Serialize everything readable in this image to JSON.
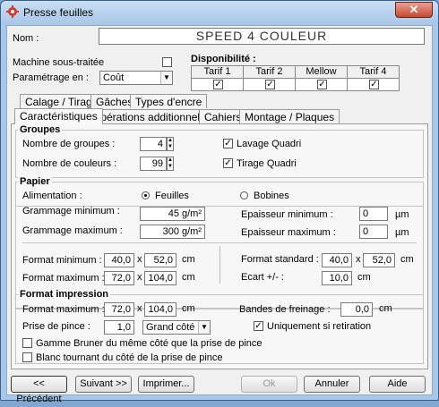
{
  "window": {
    "title": "Presse feuilles",
    "close_glyph": "✕"
  },
  "header": {
    "name_label": "Nom :",
    "name_value": "SPEED 4 COULEUR",
    "sous_traitee_label": "Machine sous-traitée",
    "parametrage_label": "Paramétrage en :",
    "parametrage_value": "Coût",
    "disponibilite_label": "Disponibilité :",
    "tarifs": [
      "Tarif 1",
      "Tarif 2",
      "Mellow",
      "Tarif 4"
    ],
    "tarifs_checked": [
      true,
      true,
      true,
      true
    ]
  },
  "tabs_row1": [
    "Calage / Tirage",
    "Gâches",
    "Types d'encre"
  ],
  "tabs_row2": [
    "Caractéristiques",
    "Opérations additionnelles",
    "Cahiers",
    "Montage / Plaques"
  ],
  "active_tab": "Caractéristiques",
  "groupes": {
    "title": "Groupes",
    "nb_groupes_label": "Nombre de groupes :",
    "nb_groupes_value": "4",
    "nb_couleurs_label": "Nombre de couleurs :",
    "nb_couleurs_value": "99",
    "lavage_label": "Lavage Quadri",
    "lavage_checked": true,
    "tirage_label": "Tirage Quadri",
    "tirage_checked": true
  },
  "papier": {
    "title": "Papier",
    "alimentation_label": "Alimentation :",
    "feuilles_label": "Feuilles",
    "bobines_label": "Bobines",
    "grammage_min_label": "Grammage minimum :",
    "grammage_min_value": "45 g/m²",
    "grammage_max_label": "Grammage maximum :",
    "grammage_max_value": "300 g/m²",
    "epaisseur_min_label": "Epaisseur minimum :",
    "epaisseur_min_value": "0",
    "epaisseur_max_label": "Epaisseur maximum :",
    "epaisseur_max_value": "0",
    "um_unit": "µm",
    "format_min_label": "Format minimum :",
    "format_min_w": "40,0",
    "format_min_h": "52,0",
    "format_max_label": "Format maximum :",
    "format_max_w": "72,0",
    "format_max_h": "104,0",
    "format_std_label": "Format standard :",
    "format_std_w": "40,0",
    "format_std_h": "52,0",
    "ecart_label": "Ecart +/- :",
    "ecart_value": "10,0",
    "cm_unit": "cm",
    "times": "x"
  },
  "format_impression": {
    "title": "Format impression",
    "format_max_label": "Format maximum :",
    "format_max_w": "72,0",
    "format_max_h": "104,0",
    "prise_label": "Prise de pince :",
    "prise_value": "1,0",
    "prise_select": "Grand côté",
    "bandes_label": "Bandes de freinage :",
    "bandes_value": "0,0",
    "retiration_label": "Uniquement si retiration",
    "retiration_checked": true,
    "gamme_label": "Gamme Bruner du même côté que la prise de pince",
    "blanc_label": "Blanc tournant du côté de la prise de pince",
    "cm_unit": "cm",
    "times": "x"
  },
  "footer": {
    "precedent": "<< Précédent",
    "suivant": "Suivant >>",
    "imprimer": "Imprimer...",
    "ok": "Ok",
    "annuler": "Annuler",
    "aide": "Aide"
  }
}
